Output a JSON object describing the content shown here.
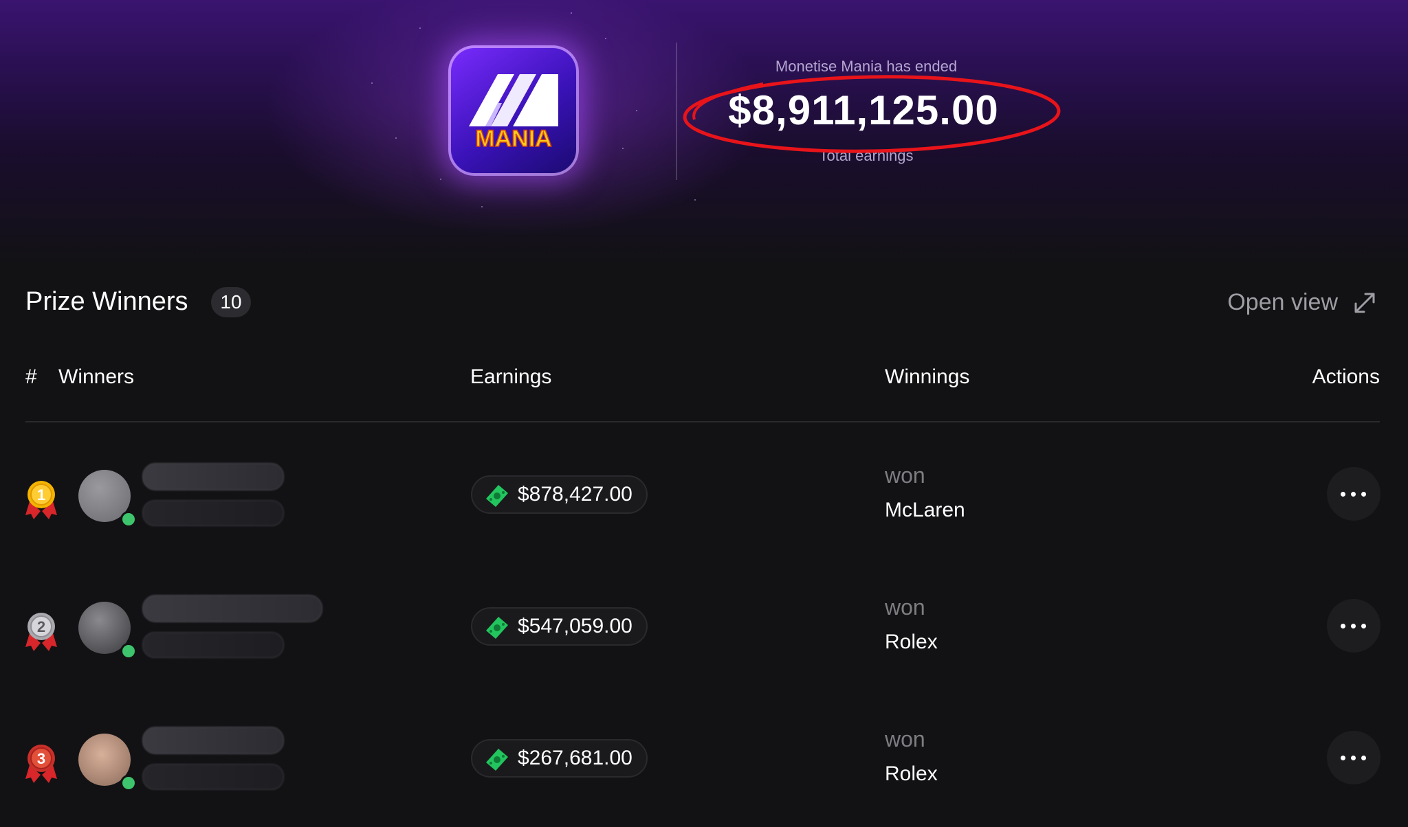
{
  "header": {
    "app_name": "MANIA",
    "ended_label": "Monetise Mania has ended",
    "total_earnings": "$8,911,125.00",
    "total_label": "Total earnings"
  },
  "section": {
    "title": "Prize Winners",
    "count": "10",
    "open_view_label": "Open view"
  },
  "table": {
    "columns": [
      "#",
      "Winners",
      "Earnings",
      "Winnings",
      "Actions"
    ],
    "rows": [
      {
        "rank": "1",
        "earnings": "$878,427.00",
        "won_label": "won",
        "prize": "McLaren",
        "medal_color": "#f4b400"
      },
      {
        "rank": "2",
        "earnings": "$547,059.00",
        "won_label": "won",
        "prize": "Rolex",
        "medal_color": "#c7c7cc"
      },
      {
        "rank": "3",
        "earnings": "$267,681.00",
        "won_label": "won",
        "prize": "Rolex",
        "medal_color": "#e2503a"
      }
    ]
  },
  "colors": {
    "accent_purple": "#7b2cff",
    "highlight_red": "#e8141a",
    "online_green": "#3ec46d",
    "cash_green": "#22c55e"
  },
  "icons": {
    "open_view": "expand-diagonal-icon",
    "earnings": "cash-icon",
    "actions": "more-horizontal-icon",
    "rank": "medal-icon"
  }
}
